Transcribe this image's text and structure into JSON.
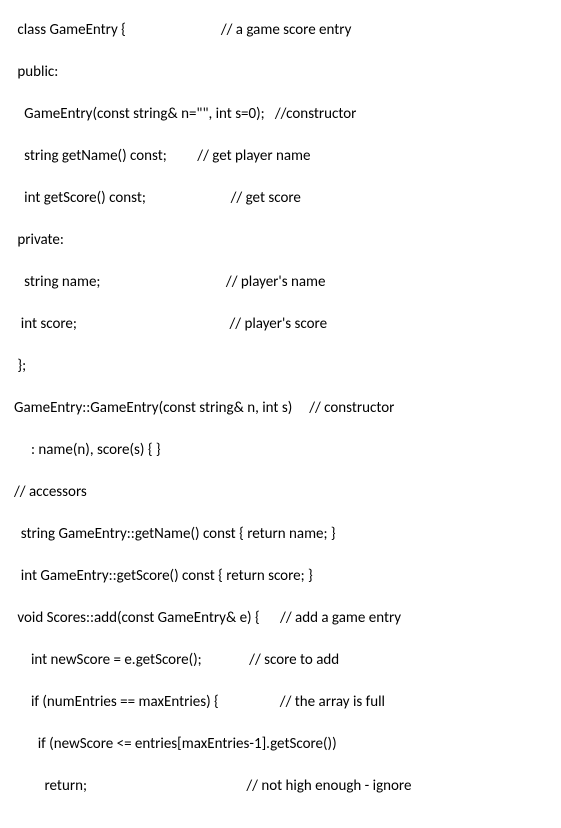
{
  "lines": [
    " class GameEntry {                            // a game score entry",
    " public:",
    "   GameEntry(const string& n=\"\", int s=0);   //constructor",
    "   string getName() const;         // get player name",
    "   int getScore() const;                         // get score",
    " private:",
    "   string name;                                     // player's name",
    "  int score;                                             // player's score",
    " };",
    "",
    "GameEntry::GameEntry(const string& n, int s)     // constructor",
    "     : name(n), score(s) { }",
    "",
    "// accessors",
    "  string GameEntry::getName() const { return name; }",
    "  int GameEntry::getScore() const { return score; }",
    "",
    " void Scores::add(const GameEntry& e) {      // add a game entry",
    "     int newScore = e.getScore();              // score to add",
    "     if (numEntries == maxEntries) {                  // the array is full",
    "       if (newScore <= entries[maxEntries-1].getScore())",
    "         return;                                               // not high enough - ignore"
  ]
}
